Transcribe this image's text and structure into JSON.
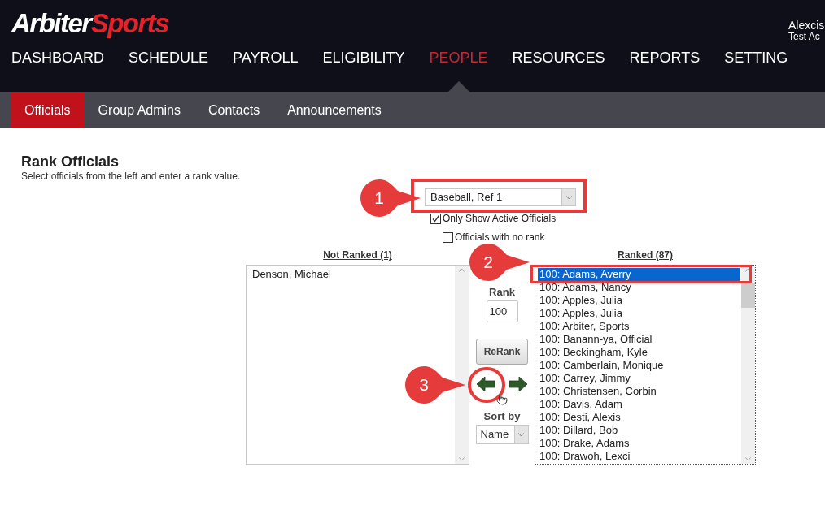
{
  "header": {
    "logo": {
      "first": "Arbiter",
      "second": "Sports"
    },
    "user": {
      "name": "Alexcis",
      "account": "Test Ac"
    }
  },
  "nav": [
    {
      "label": "DASHBOARD",
      "selected": false
    },
    {
      "label": "SCHEDULE",
      "selected": false
    },
    {
      "label": "PAYROLL",
      "selected": false
    },
    {
      "label": "ELIGIBILITY",
      "selected": false
    },
    {
      "label": "PEOPLE",
      "selected": true
    },
    {
      "label": "RESOURCES",
      "selected": false
    },
    {
      "label": "REPORTS",
      "selected": false
    },
    {
      "label": "SETTING",
      "selected": false
    }
  ],
  "subnav": [
    {
      "label": "Officials",
      "selected": true
    },
    {
      "label": "Group Admins",
      "selected": false
    },
    {
      "label": "Contacts",
      "selected": false
    },
    {
      "label": "Announcements",
      "selected": false
    }
  ],
  "page": {
    "title": "Rank Officials",
    "subtitle": "Select officials from the left and enter a rank value."
  },
  "sport_select": {
    "value": "Baseball, Ref 1"
  },
  "filters": [
    {
      "label": "Only Show Active Officials",
      "checked": true
    },
    {
      "label": "Officials with no rank",
      "checked": false
    }
  ],
  "not_ranked": {
    "heading": "Not Ranked (1)",
    "items": [
      {
        "name": "Denson, Michael",
        "selected": false
      }
    ]
  },
  "rank": {
    "label": "Rank",
    "value": "100"
  },
  "rerank_button": "ReRank",
  "sort": {
    "label": "Sort by",
    "value": "Name"
  },
  "ranked": {
    "heading": "Ranked (87)",
    "items": [
      {
        "name": "100: Adams, Averry",
        "selected": true
      },
      {
        "name": "100: Adams, Nancy",
        "selected": false
      },
      {
        "name": "100: Apples, Julia",
        "selected": false
      },
      {
        "name": "100: Apples, Julia",
        "selected": false
      },
      {
        "name": "100: Arbiter, Sports",
        "selected": false
      },
      {
        "name": "100: Banann-ya, Official",
        "selected": false
      },
      {
        "name": "100: Beckingham, Kyle",
        "selected": false
      },
      {
        "name": "100: Camberlain, Monique",
        "selected": false
      },
      {
        "name": "100: Carrey, Jimmy",
        "selected": false
      },
      {
        "name": "100: Christensen, Corbin",
        "selected": false
      },
      {
        "name": "100: Davis, Adam",
        "selected": false
      },
      {
        "name": "100: Desti, Alexis",
        "selected": false
      },
      {
        "name": "100: Dillard, Bob",
        "selected": false
      },
      {
        "name": "100: Drake, Adams",
        "selected": false
      },
      {
        "name": "100: Drawoh, Lexci",
        "selected": false
      }
    ]
  },
  "callouts": [
    "1",
    "2",
    "3"
  ]
}
